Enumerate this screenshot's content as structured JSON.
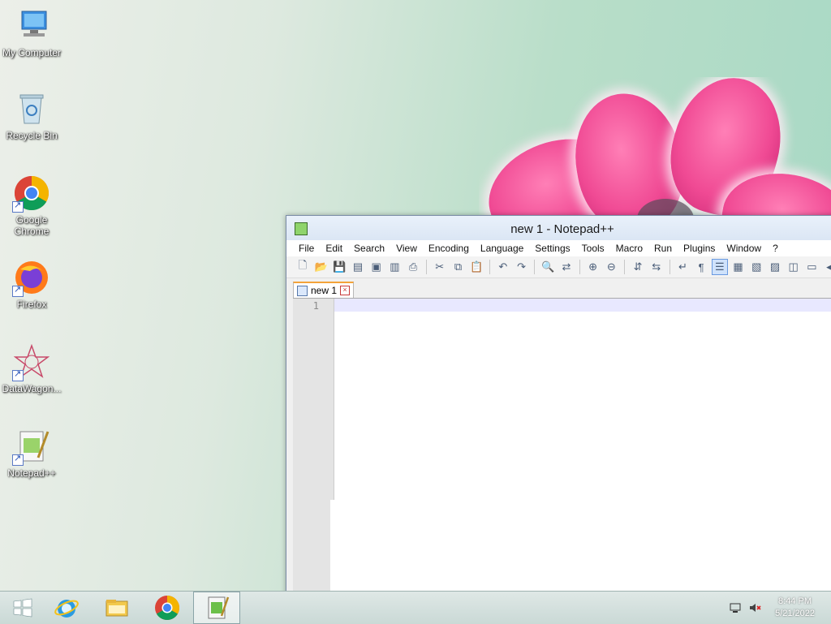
{
  "desktop": {
    "icons": [
      {
        "label": "My Computer"
      },
      {
        "label": "Recycle Bin"
      },
      {
        "label": "Google Chrome"
      },
      {
        "label": "Firefox"
      },
      {
        "label": "DataWagon..."
      },
      {
        "label": "Notepad++"
      }
    ]
  },
  "window": {
    "title": "new 1 - Notepad++",
    "menu": [
      "File",
      "Edit",
      "Search",
      "View",
      "Encoding",
      "Language",
      "Settings",
      "Tools",
      "Macro",
      "Run",
      "Plugins",
      "Window",
      "?"
    ],
    "tab_label": "new 1",
    "line_numbers": [
      "1"
    ]
  },
  "taskbar": {
    "time": "8:44 PM",
    "date": "5/21/2022"
  },
  "colors": {
    "accent_tab": "#f3a33a",
    "current_line": "#e8e8ff"
  }
}
